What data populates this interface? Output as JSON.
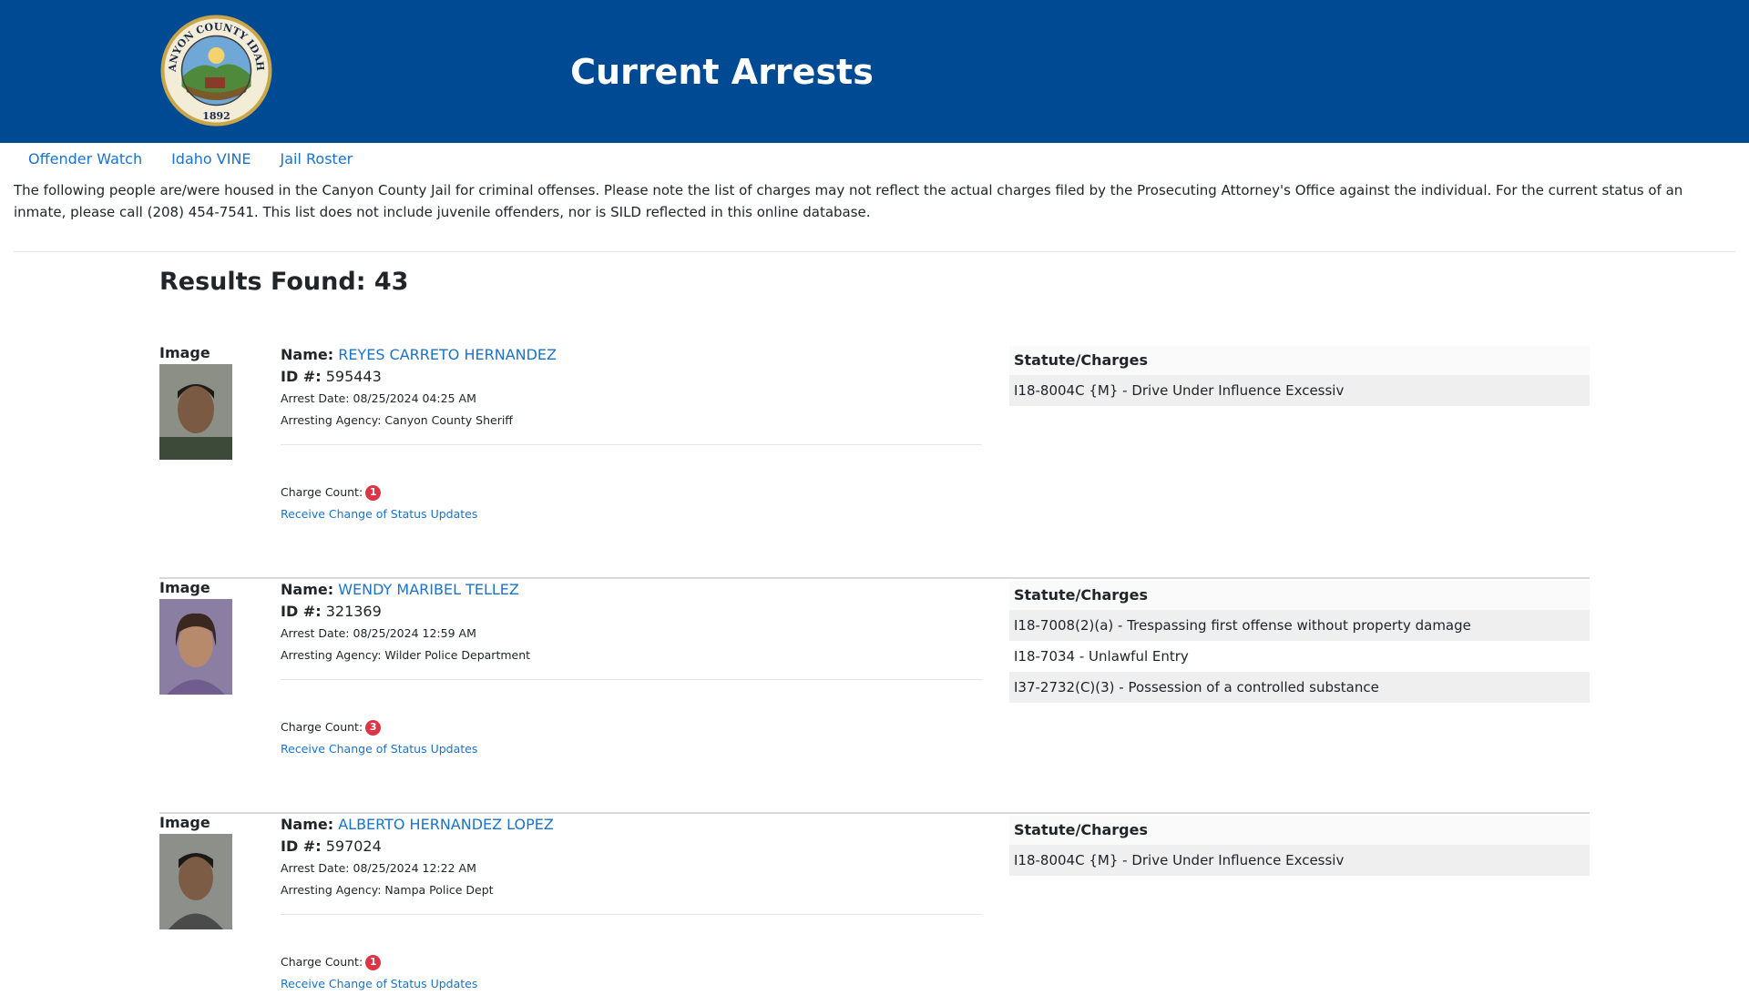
{
  "header": {
    "title": "Current Arrests",
    "seal": {
      "top_text": "CANYON COUNTY IDAHO",
      "year": "1892"
    }
  },
  "nav": [
    {
      "label": "Offender Watch"
    },
    {
      "label": "Idaho VINE"
    },
    {
      "label": "Jail Roster"
    }
  ],
  "notice": "The following people are/were housed in the Canyon County Jail for criminal offenses. Please note the list of charges may not reflect the actual charges filed by the Prosecuting Attorney's Office against the individual. For the current status of an inmate, please call (208) 454-7541. This list does not include juvenile offenders, nor is SILD reflected in this online database.",
  "results": {
    "label": "Results Found: 43"
  },
  "labels": {
    "image": "Image",
    "name": "Name:",
    "id": "ID #:",
    "arrest_date": "Arrest Date:",
    "agency": "Arresting Agency:",
    "charge_count": "Charge Count:",
    "status_link": "Receive Change of Status Updates",
    "charges_header": "Statute/Charges"
  },
  "records": [
    {
      "name": "REYES CARRETO HERNANDEZ",
      "id": "595443",
      "arrest_date": "08/25/2024 04:25 AM",
      "agency": "Canyon County Sheriff",
      "charge_count": "1",
      "charges": [
        "I18-8004C {M} - Drive Under Influence Excessiv"
      ]
    },
    {
      "name": "WENDY MARIBEL TELLEZ",
      "id": "321369",
      "arrest_date": "08/25/2024 12:59 AM",
      "agency": "Wilder Police Department",
      "charge_count": "3",
      "charges": [
        "I18-7008(2)(a) - Trespassing first offense without property damage",
        "I18-7034 - Unlawful Entry",
        "I37-2732(C)(3) - Possession of a controlled substance"
      ]
    },
    {
      "name": "ALBERTO HERNANDEZ LOPEZ",
      "id": "597024",
      "arrest_date": "08/25/2024 12:22 AM",
      "agency": "Nampa Police Dept",
      "charge_count": "1",
      "charges": [
        "I18-8004C {M} - Drive Under Influence Excessiv"
      ]
    }
  ]
}
